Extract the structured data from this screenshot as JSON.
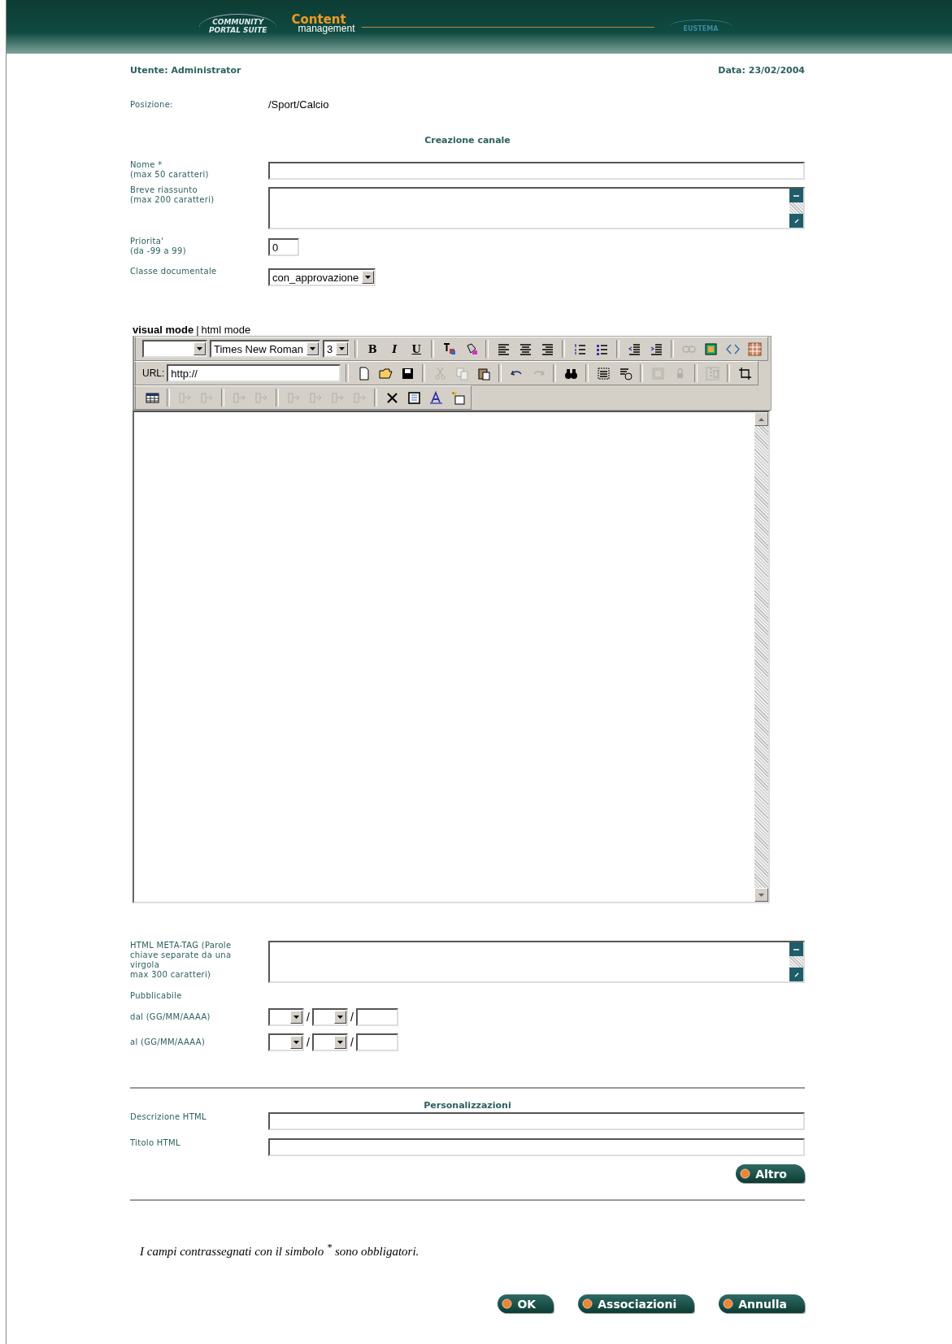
{
  "header": {
    "logo_top": "COMMUNITY",
    "logo_bottom": "PORTAL SUITE",
    "product": "Content",
    "product_sub": "management",
    "partner": "EUSTEMA"
  },
  "user": "Utente: Administrator",
  "date": "Data: 23/02/2004",
  "position": {
    "label": "Posizione:",
    "value": "/Sport/Calcio"
  },
  "section_title": "Creazione canale",
  "fields": [
    {
      "kind": "text",
      "label": "Nome *\n(max 50 caratteri)"
    },
    {
      "kind": "textarea",
      "label": "Breve riassunto\n(max 200 caratteri)"
    },
    {
      "kind": "small",
      "label": "Priorita'\n(da -99 a 99)",
      "value": "0"
    },
    {
      "kind": "select",
      "label": "Classe documentale",
      "value": "con_approvazione"
    }
  ],
  "editor": {
    "modes": [
      {
        "label": "visual mode",
        "selected": true
      },
      {
        "label": "html mode",
        "selected": false
      }
    ],
    "mode_divider": "|",
    "toolbars": [
      {
        "groups": [
          [
            {
              "kind": "select"
            },
            {
              "kind": "select",
              "value": "Times New Roman"
            },
            {
              "kind": "select",
              "value": "3"
            }
          ],
          [
            {
              "kind": "bold",
              "label": "B",
              "disabled": false
            },
            {
              "kind": "italic",
              "label": "I",
              "disabled": false
            },
            {
              "kind": "underline",
              "label": "U",
              "disabled": false
            }
          ],
          [
            {
              "kind": "text-color",
              "disabled": false
            },
            {
              "kind": "fill-color",
              "disabled": false
            }
          ],
          [
            {
              "kind": "align-left",
              "disabled": false
            },
            {
              "kind": "align-center",
              "disabled": false
            },
            {
              "kind": "align-right",
              "disabled": false
            }
          ],
          [
            {
              "kind": "numbered-list",
              "disabled": false
            },
            {
              "kind": "bullet-list",
              "disabled": false
            }
          ],
          [
            {
              "kind": "outdent",
              "disabled": false
            },
            {
              "kind": "indent",
              "disabled": false
            }
          ],
          [
            {
              "kind": "link",
              "disabled": true
            },
            {
              "kind": "image",
              "disabled": false
            },
            {
              "kind": "code",
              "disabled": false
            },
            {
              "kind": "table-color",
              "disabled": false
            }
          ]
        ]
      },
      {
        "groups": [
          [
            {
              "kind": "url",
              "label": "URL:",
              "value": "http://"
            }
          ],
          [
            {
              "kind": "page",
              "disabled": false
            },
            {
              "kind": "folder",
              "disabled": false
            },
            {
              "kind": "disk",
              "disabled": false
            }
          ],
          [
            {
              "kind": "scissors",
              "disabled": true
            },
            {
              "kind": "copy",
              "disabled": true
            },
            {
              "kind": "paste",
              "disabled": false
            }
          ],
          [
            {
              "kind": "undo",
              "disabled": false
            },
            {
              "kind": "redo",
              "disabled": true
            }
          ],
          [
            {
              "kind": "binoculars",
              "disabled": false
            }
          ],
          [
            {
              "kind": "select-all",
              "disabled": false
            },
            {
              "kind": "format",
              "disabled": false
            }
          ],
          [
            {
              "kind": "frame",
              "disabled": true
            },
            {
              "kind": "lock",
              "disabled": true
            }
          ],
          [
            {
              "kind": "layout",
              "disabled": true
            }
          ],
          [
            {
              "kind": "crop",
              "disabled": false
            }
          ]
        ]
      },
      {
        "groups": [
          [
            {
              "kind": "table",
              "disabled": false
            }
          ],
          [
            {
              "kind": "split-cell",
              "disabled": true
            },
            {
              "kind": "merge-cell",
              "disabled": true
            }
          ],
          [
            {
              "kind": "insert-row",
              "disabled": true
            },
            {
              "kind": "delete-row",
              "disabled": true
            }
          ],
          [
            {
              "kind": "column-left",
              "disabled": true
            },
            {
              "kind": "column-right",
              "disabled": true
            },
            {
              "kind": "insert-column",
              "disabled": true
            },
            {
              "kind": "delete-column",
              "disabled": true
            }
          ],
          [
            {
              "kind": "cross",
              "disabled": false
            },
            {
              "kind": "grid",
              "disabled": false
            },
            {
              "kind": "style",
              "disabled": false
            },
            {
              "kind": "new-cell",
              "disabled": false
            }
          ]
        ]
      }
    ]
  },
  "meta": {
    "label": "HTML META-TAG (Parole\nchiave separate da una\nvirgola\nmax 300 caratteri)"
  },
  "publish": {
    "title": "Pubblicabile",
    "ranges": [
      {
        "label": "dal (GG/MM/AAAA)",
        "separators": [
          "/",
          "/"
        ]
      },
      {
        "label": "al (GG/MM/AAAA)",
        "separators": [
          "/",
          "/"
        ]
      }
    ]
  },
  "custom": {
    "title": "Personalizzazioni",
    "fields": [
      {
        "label": "Descrizione HTML"
      },
      {
        "label": "Titolo HTML"
      }
    ],
    "more": "Altro"
  },
  "note": "I campi contrassegnati con il simbolo $^{*}$ sono obbligatori.",
  "actions": [
    "OK",
    "Associazioni",
    "Annulla"
  ]
}
